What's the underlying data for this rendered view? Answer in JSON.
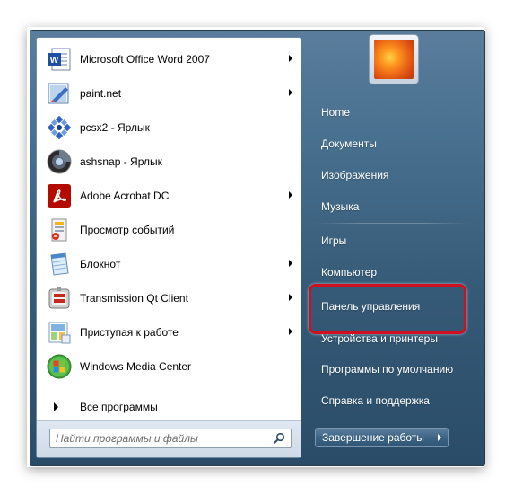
{
  "pinned_programs": [
    {
      "label": "Microsoft Office Word 2007",
      "icon": "word-icon",
      "has_submenu": true
    },
    {
      "label": "paint.net",
      "icon": "paintnet-icon",
      "has_submenu": true
    },
    {
      "label": "pcsx2 - Ярлык",
      "icon": "pcsx2-icon",
      "has_submenu": false
    },
    {
      "label": "ashsnap - Ярлык",
      "icon": "ashsnap-icon",
      "has_submenu": false
    },
    {
      "label": "Adobe Acrobat DC",
      "icon": "acrobat-icon",
      "has_submenu": true
    },
    {
      "label": "Просмотр событий",
      "icon": "event-viewer-icon",
      "has_submenu": false
    },
    {
      "label": "Блокнот",
      "icon": "notepad-icon",
      "has_submenu": true
    },
    {
      "label": "Transmission Qt Client",
      "icon": "transmission-icon",
      "has_submenu": true
    },
    {
      "label": "Приступая к работе",
      "icon": "getting-started-icon",
      "has_submenu": true
    },
    {
      "label": "Windows Media Center",
      "icon": "media-center-icon",
      "has_submenu": false
    }
  ],
  "all_programs_label": "Все программы",
  "search": {
    "placeholder": "Найти программы и файлы"
  },
  "right_items": [
    {
      "label": "Home"
    },
    {
      "label": "Документы"
    },
    {
      "label": "Изображения"
    },
    {
      "label": "Музыка"
    },
    {
      "label": "Игры"
    },
    {
      "label": "Компьютер"
    },
    {
      "label": "Панель управления"
    },
    {
      "label": "Устройства и принтеры"
    },
    {
      "label": "Программы по умолчанию"
    },
    {
      "label": "Справка и поддержка"
    }
  ],
  "shutdown_label": "Завершение работы",
  "colors": {
    "highlight": "#d10f1f",
    "menu_blue": "#3d6383"
  }
}
